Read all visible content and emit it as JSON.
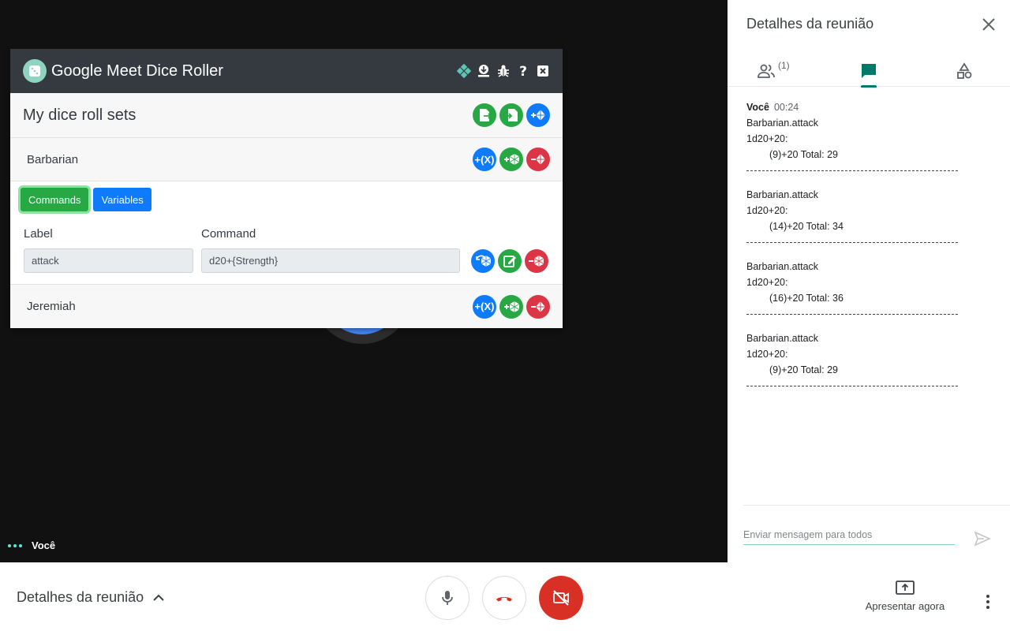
{
  "self_name": "Você",
  "dice_roller": {
    "title": "Google Meet Dice Roller",
    "sets_title": "My dice roll sets",
    "sets": [
      {
        "name": "Barbarian"
      },
      {
        "name": "Jeremiah"
      }
    ],
    "tabs": {
      "commands": "Commands",
      "variables": "Variables"
    },
    "fields": {
      "label_header": "Label",
      "command_header": "Command"
    },
    "command": {
      "label": "attack",
      "command": "d20+{Strength}"
    },
    "add_variable_label": "+(X)",
    "colors": {
      "header": "#343a40",
      "blue": "#0d7bfb",
      "green": "#28a745",
      "red": "#dc3545"
    }
  },
  "sidebar": {
    "title": "Detalhes da reunião",
    "people_count": "(1)",
    "chat": {
      "sender": "Você",
      "time": "00:24",
      "messages": [
        {
          "command": "Barbarian.attack",
          "expr": "1d20+20:",
          "result": "(9)+20  Total: 29"
        },
        {
          "command": "Barbarian.attack",
          "expr": "1d20+20:",
          "result": "(14)+20  Total: 34"
        },
        {
          "command": "Barbarian.attack",
          "expr": "1d20+20:",
          "result": "(16)+20  Total: 36"
        },
        {
          "command": "Barbarian.attack",
          "expr": "1d20+20:",
          "result": "(9)+20  Total: 29"
        }
      ]
    },
    "compose_placeholder": "Enviar mensagem para todos"
  },
  "bottom_bar": {
    "meeting_details": "Detalhes da reunião",
    "present_now": "Apresentar agora"
  }
}
